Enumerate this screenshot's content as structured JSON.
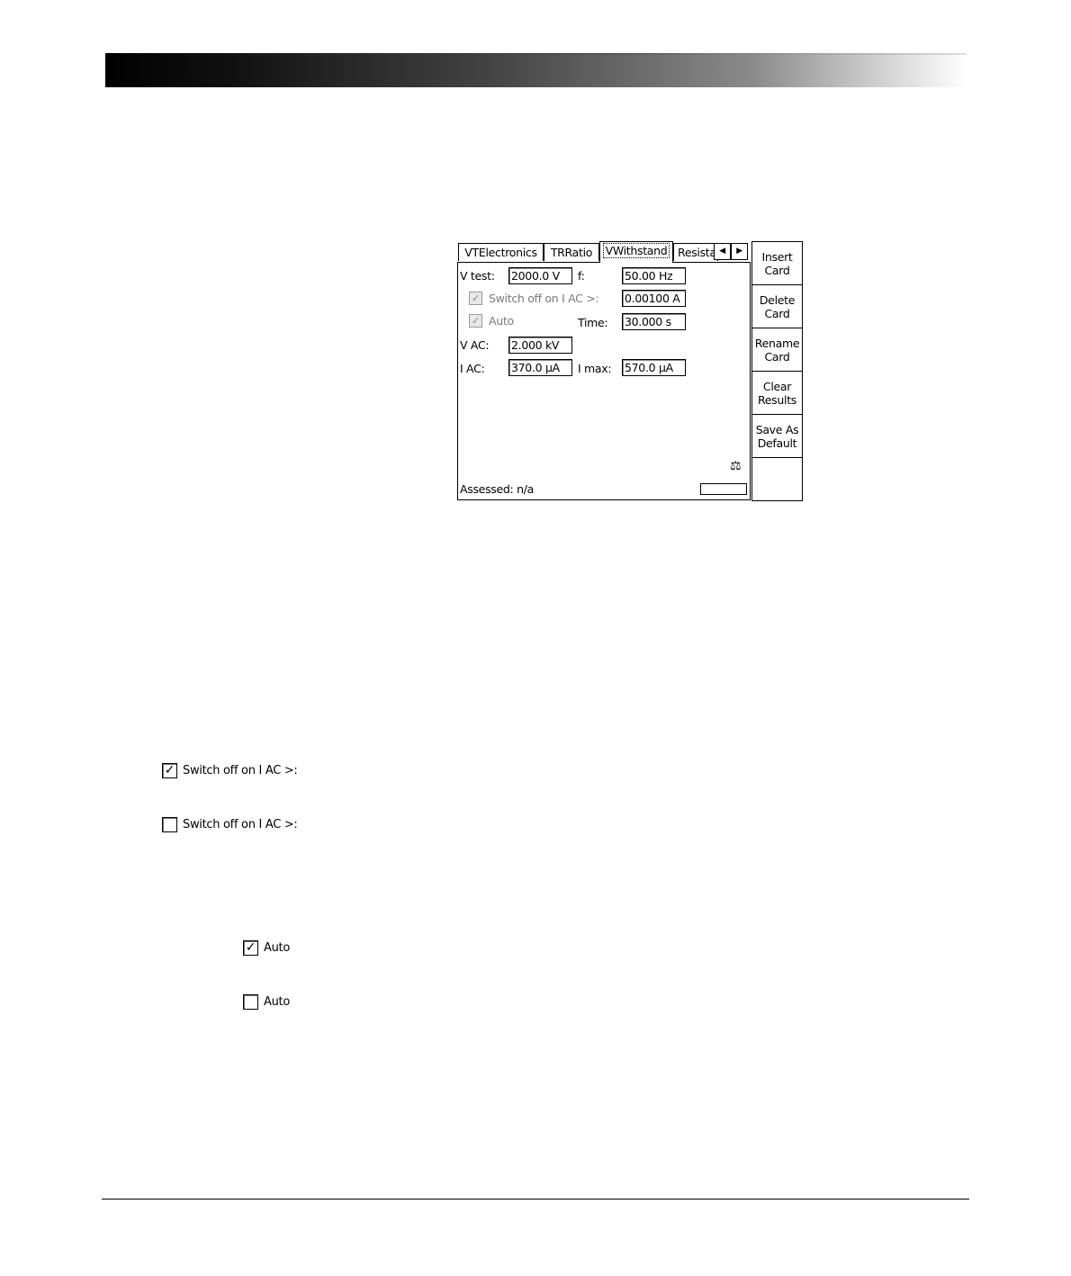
{
  "device": {
    "tabs": [
      {
        "label": "VTElectronics"
      },
      {
        "label": "TRRatio"
      },
      {
        "label": "VWithstand"
      },
      {
        "label": "Resista"
      }
    ],
    "arrows": {
      "left": "◀",
      "right": "▶"
    },
    "fields": {
      "v_test_label": "V test:",
      "v_test_value": "2000.0 V",
      "f_label": "f:",
      "f_value": "50.00 Hz",
      "switch_off_label": "Switch off on I AC >:",
      "switch_off_value": "0.00100 A",
      "auto_label": "Auto",
      "time_label": "Time:",
      "time_value": "30.000 s",
      "v_ac_label": "V AC:",
      "v_ac_value": "2.000 kV",
      "i_ac_label": "I AC:",
      "i_ac_value": "370.0 µA",
      "i_max_label": "I max:",
      "i_max_value": "570.0 µA"
    },
    "assessed": "Assessed: n/a",
    "side_buttons": [
      {
        "line1": "Insert",
        "line2": "Card"
      },
      {
        "line1": "Delete",
        "line2": "Card"
      },
      {
        "line1": "Rename",
        "line2": "Card"
      },
      {
        "line1": "Clear",
        "line2": "Results"
      },
      {
        "line1": "Save As",
        "line2": "Default"
      }
    ]
  },
  "samples": {
    "switch_checked": {
      "label": "Switch off on I AC >:",
      "checked": true
    },
    "switch_unchecked": {
      "label": "Switch off on I AC >:",
      "checked": false
    },
    "auto_checked": {
      "label": "Auto",
      "checked": true
    },
    "auto_unchecked": {
      "label": "Auto",
      "checked": false
    }
  }
}
